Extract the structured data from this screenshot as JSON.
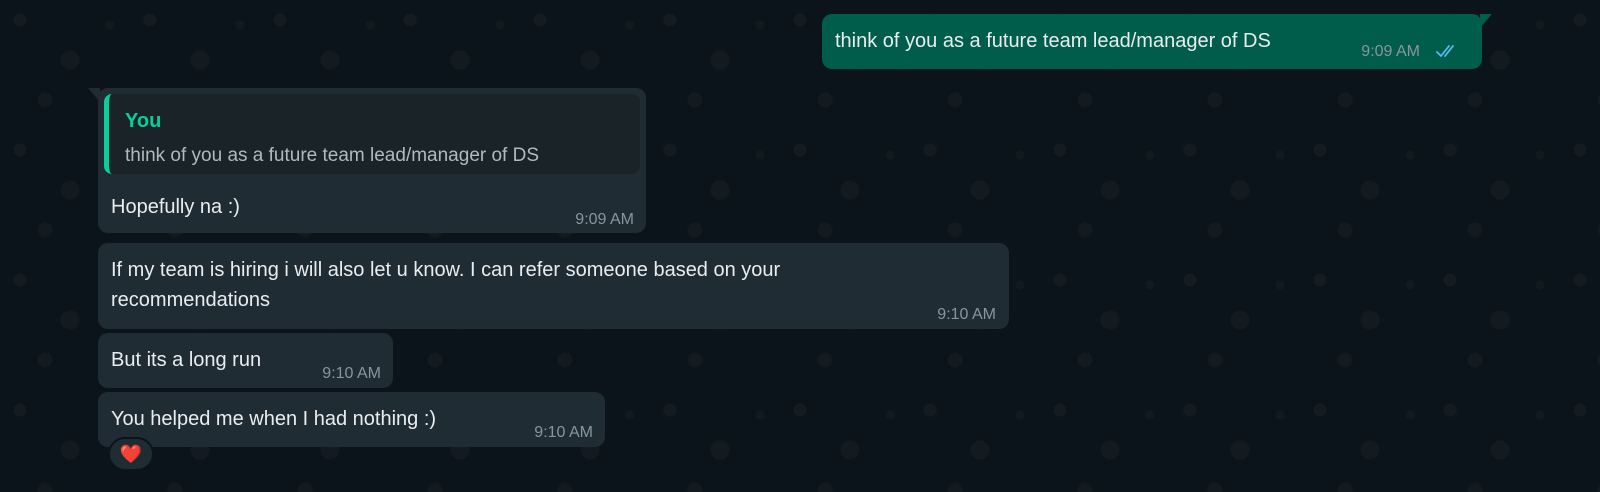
{
  "messages": {
    "m1": {
      "text": "think of you as a future team lead/manager of DS",
      "time": "9:09 AM",
      "status_icon": "double-check-read-icon"
    },
    "m2": {
      "quote": {
        "author": "You",
        "text": "think of you as a future team lead/manager of DS"
      },
      "text": "Hopefully na :)",
      "time": "9:09 AM"
    },
    "m3": {
      "line1": "If my team is hiring i will also let u know. I can refer someone based on your",
      "line2": "recommendations",
      "time": "9:10 AM"
    },
    "m4": {
      "text": "But its a long run",
      "time": "9:10 AM"
    },
    "m5": {
      "text": "You helped me when I had nothing :)",
      "time": "9:10 AM",
      "reaction": "❤️"
    }
  },
  "colors": {
    "background": "#0b141a",
    "incoming_bubble": "#202c33",
    "outgoing_bubble": "#005c4b",
    "quote_accent": "#06cf9c",
    "read_tick": "#53bdeb"
  }
}
